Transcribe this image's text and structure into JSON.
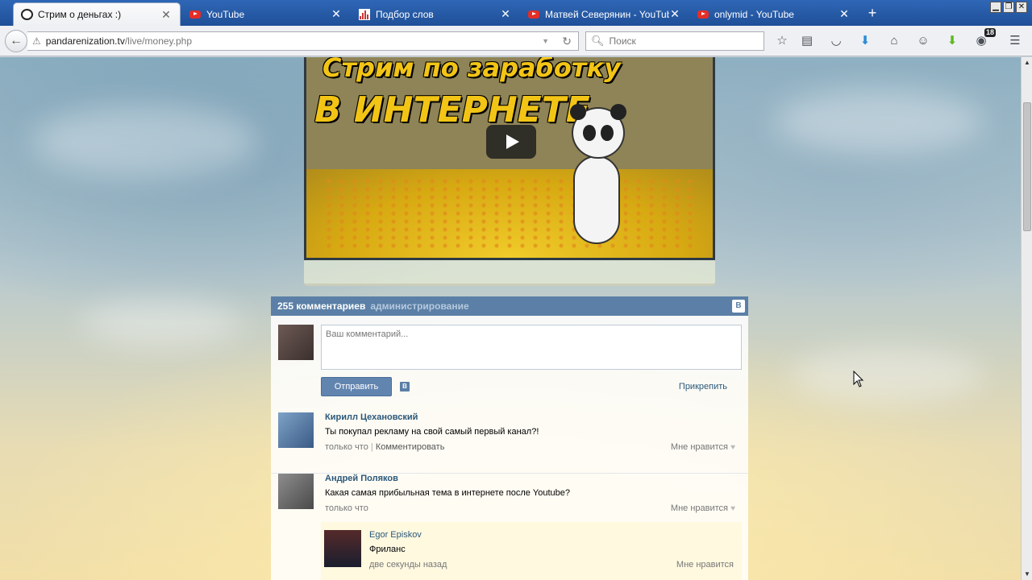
{
  "tabs": [
    {
      "title": "Стрим о деньгах :)",
      "icon": "panda-icon",
      "active": true
    },
    {
      "title": "YouTube",
      "icon": "youtube-icon",
      "active": false
    },
    {
      "title": "Подбор слов",
      "icon": "bar-chart-icon",
      "active": false
    },
    {
      "title": "Матвей Северянин - YouTube",
      "icon": "youtube-icon",
      "active": false
    },
    {
      "title": "onlymid - YouTube",
      "icon": "youtube-icon",
      "active": false
    }
  ],
  "address": {
    "host": "pandarenization.tv",
    "path": "/live/money.php"
  },
  "search": {
    "placeholder": "Поиск"
  },
  "toolbar": {
    "notification_count": "18"
  },
  "video": {
    "title_line1": "Стрим по заработку",
    "title_line2": "В ИНТЕРНЕТЕ"
  },
  "comments_widget": {
    "count_label": "255 комментариев",
    "admin_link": "администрирование",
    "input_placeholder": "Ваш комментарий...",
    "send_label": "Отправить",
    "vk_label": "В",
    "attach_label": "Прикрепить",
    "comments": [
      {
        "author": "Кирилл Цехановский",
        "text": "Ты покупал рекламу на свой самый первый канал?!",
        "time": "только что",
        "separator": "|",
        "action": "Комментировать",
        "like": "Мне нравится"
      },
      {
        "author": "Андрей Поляков",
        "text": "Какая самая прибыльная тема в интернете после Youtube?",
        "time": "только что",
        "like": "Мне нравится"
      }
    ],
    "reply": {
      "author": "Egor Episkov",
      "text": "Фриланс",
      "time": "две секунды назад",
      "like": "Мне нравится"
    }
  }
}
